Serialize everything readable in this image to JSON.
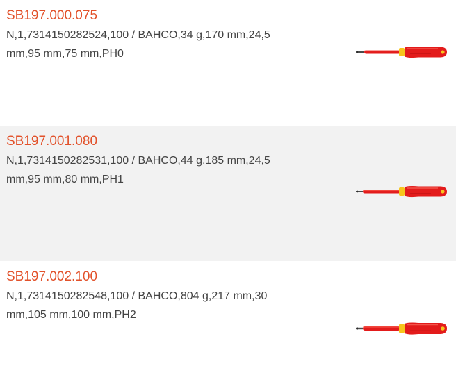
{
  "products": [
    {
      "sku": "SB197.000.075",
      "specs": "N,1,7314150282524,100 / BAHCO,34 g,170 mm,24,5 mm,95 mm,75 mm,PH0",
      "image_icon": "insulated-screwdriver-icon"
    },
    {
      "sku": "SB197.001.080",
      "specs": "N,1,7314150282531,100 / BAHCO,44 g,185 mm,24,5 mm,95 mm,80 mm,PH1",
      "image_icon": "insulated-screwdriver-icon"
    },
    {
      "sku": "SB197.002.100",
      "specs": "N,1,7314150282548,100 / BAHCO,804 g,217 mm,30 mm,105 mm,100 mm,PH2",
      "image_icon": "insulated-screwdriver-icon"
    }
  ],
  "colors": {
    "sku": "#e2512a",
    "text": "#444444",
    "alt_row": "#f2f2f2",
    "handle_red": "#e31b1b",
    "handle_yellow": "#f7c51c",
    "tip": "#4a4a4a"
  }
}
